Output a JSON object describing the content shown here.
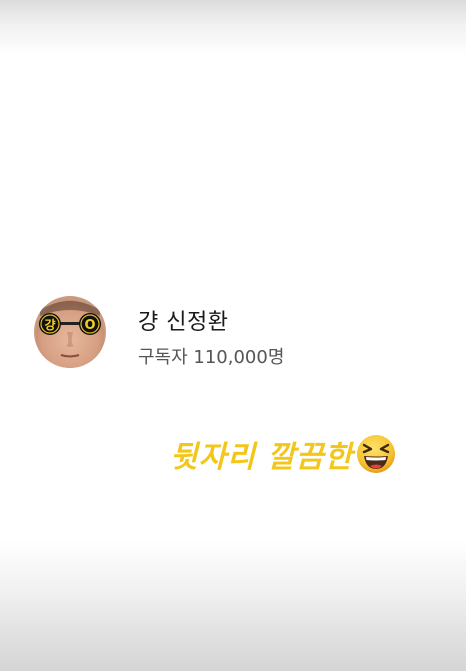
{
  "channel": {
    "name": "걍 신정환",
    "subscribers": "구독자 110,000명",
    "avatar_glasses_left_text": "걍",
    "avatar_glasses_right_text": "O"
  },
  "caption": {
    "text": "뒷자리 깔끔한",
    "color": "#f3c71a",
    "emoji_icon": "grinning-squinting-face-icon"
  }
}
